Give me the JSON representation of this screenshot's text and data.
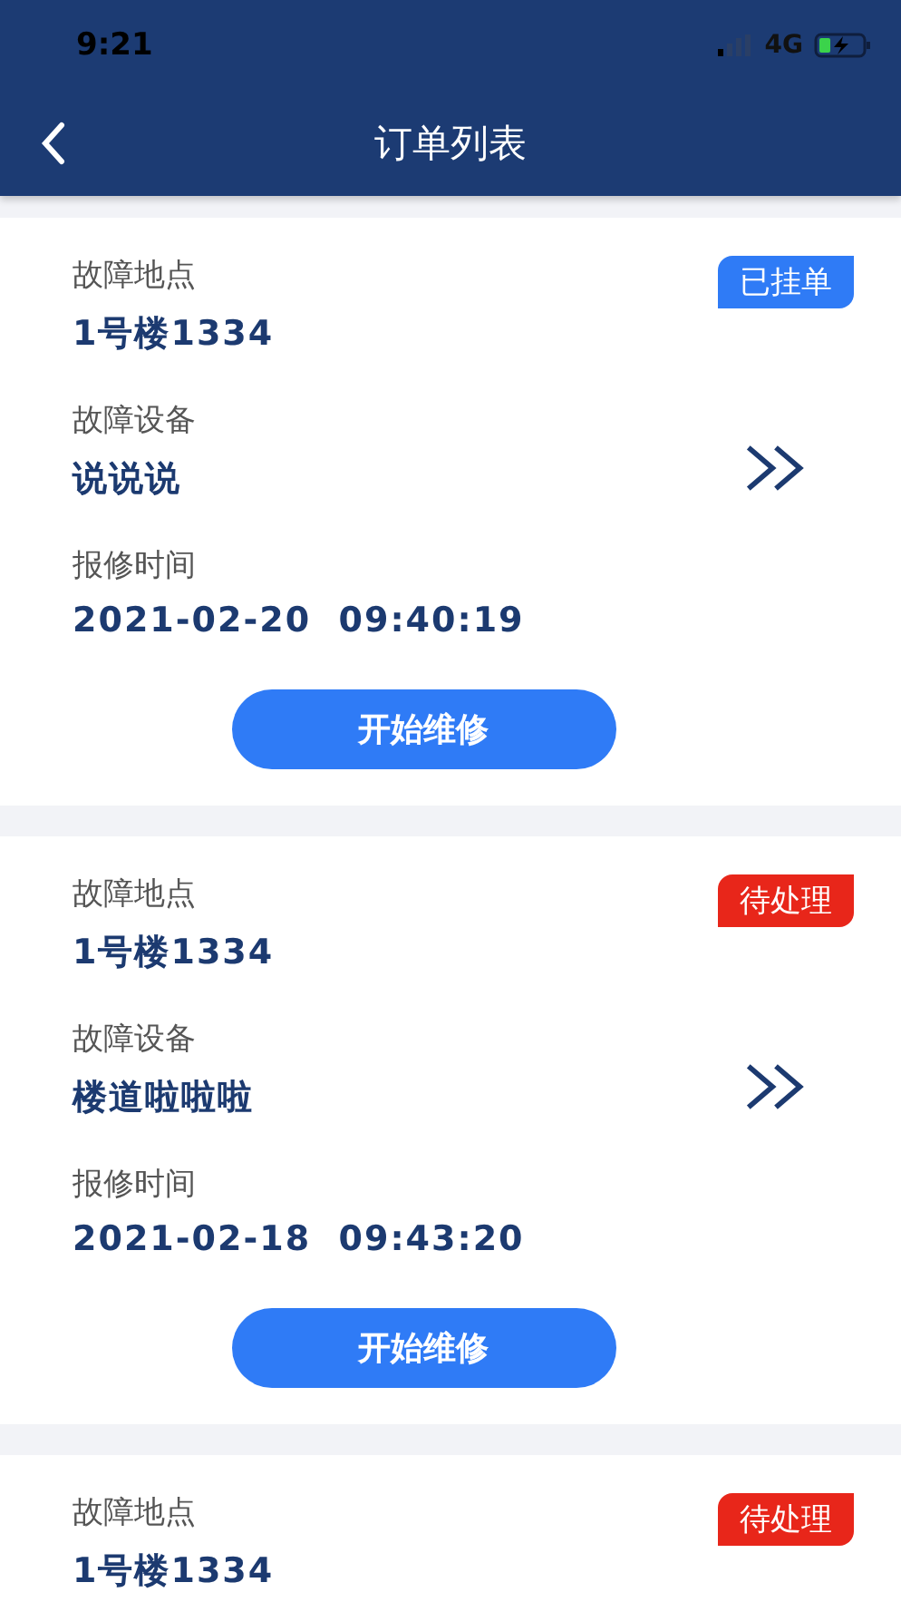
{
  "status_bar": {
    "time": "9:21",
    "network": "4G"
  },
  "nav_bar": {
    "title": "订单列表"
  },
  "orders": [
    {
      "badge": {
        "text": "已挂单",
        "color": "#2f7bf6"
      },
      "fields": [
        {
          "label": "故障地点",
          "value": "1号楼1334"
        },
        {
          "label": "故障设备",
          "value": "说说说"
        },
        {
          "label": "报修时间",
          "value": "2021-02-20  09:40:19"
        }
      ],
      "button": "开始维修"
    },
    {
      "badge": {
        "text": "待处理",
        "color": "#e8261a"
      },
      "fields": [
        {
          "label": "故障地点",
          "value": "1号楼1334"
        },
        {
          "label": "故障设备",
          "value": "楼道啦啦啦"
        },
        {
          "label": "报修时间",
          "value": "2021-02-18  09:43:20"
        }
      ],
      "button": "开始维修"
    },
    {
      "badge": {
        "text": "待处理",
        "color": "#e8261a"
      },
      "fields": [
        {
          "label": "故障地点",
          "value": "1号楼1334"
        }
      ]
    }
  ]
}
